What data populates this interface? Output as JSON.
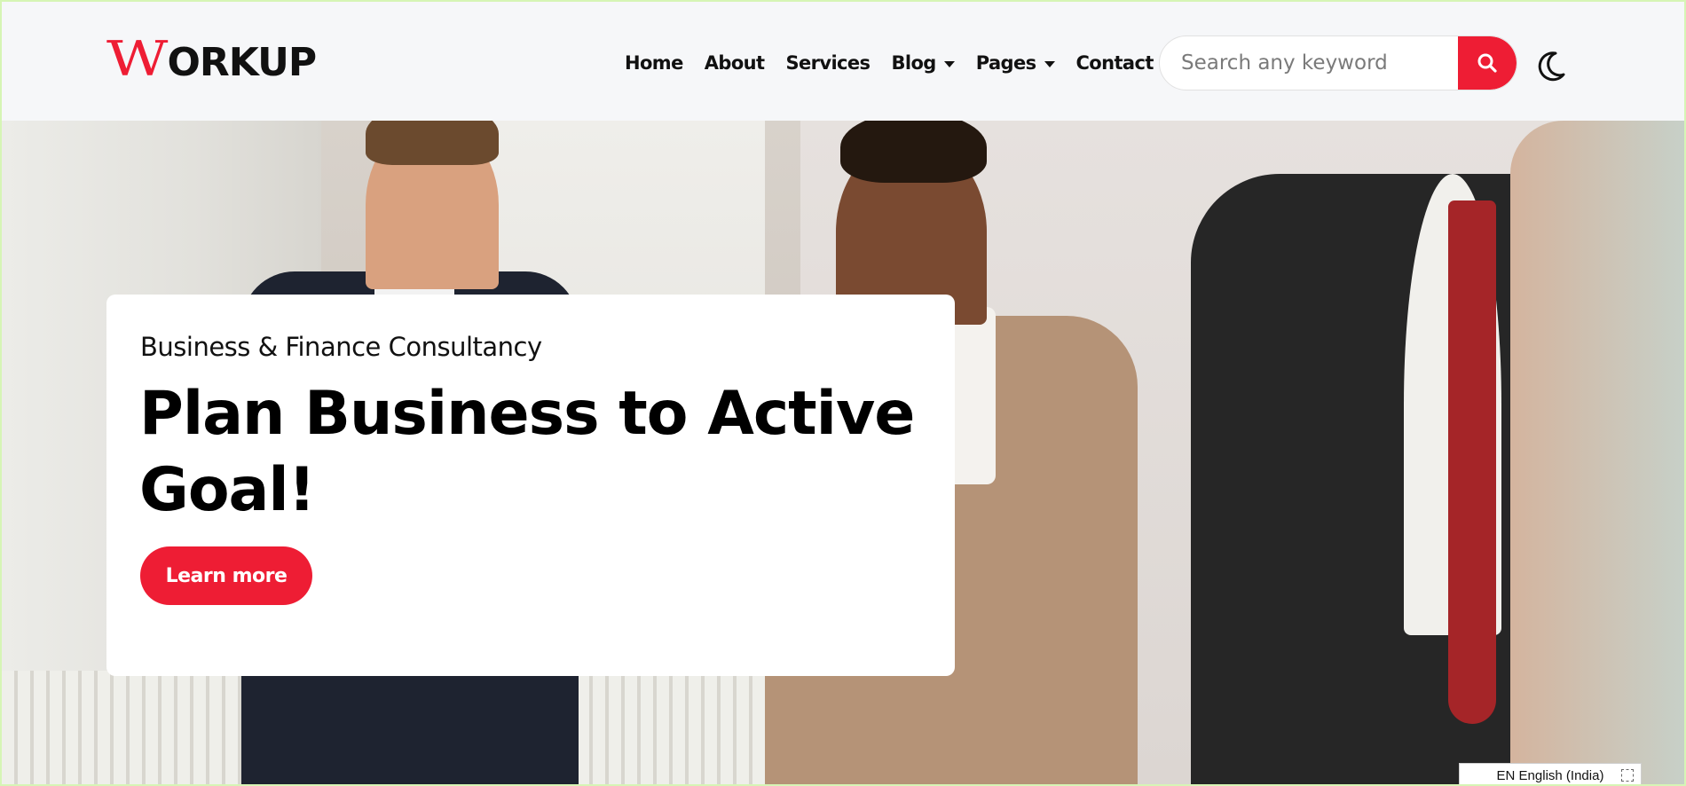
{
  "header": {
    "logo": {
      "first_letter": "W",
      "rest": "ORKUP"
    },
    "nav": [
      {
        "label": "Home",
        "has_dropdown": false
      },
      {
        "label": "About",
        "has_dropdown": false
      },
      {
        "label": "Services",
        "has_dropdown": false
      },
      {
        "label": "Blog",
        "has_dropdown": true
      },
      {
        "label": "Pages",
        "has_dropdown": true
      },
      {
        "label": "Contact",
        "has_dropdown": false
      }
    ],
    "search": {
      "placeholder": "Search any keyword",
      "value": "",
      "button_icon": "search-icon"
    },
    "theme_toggle_icon": "moon-icon"
  },
  "hero": {
    "subtitle": "Business & Finance Consultancy",
    "title": "Plan Business to Active Goal!",
    "cta_label": "Learn more"
  },
  "taskbar": {
    "language": "EN English (India)"
  },
  "colors": {
    "accent": "#ee1d34",
    "header_bg": "#f6f7f9",
    "text": "#111111"
  }
}
